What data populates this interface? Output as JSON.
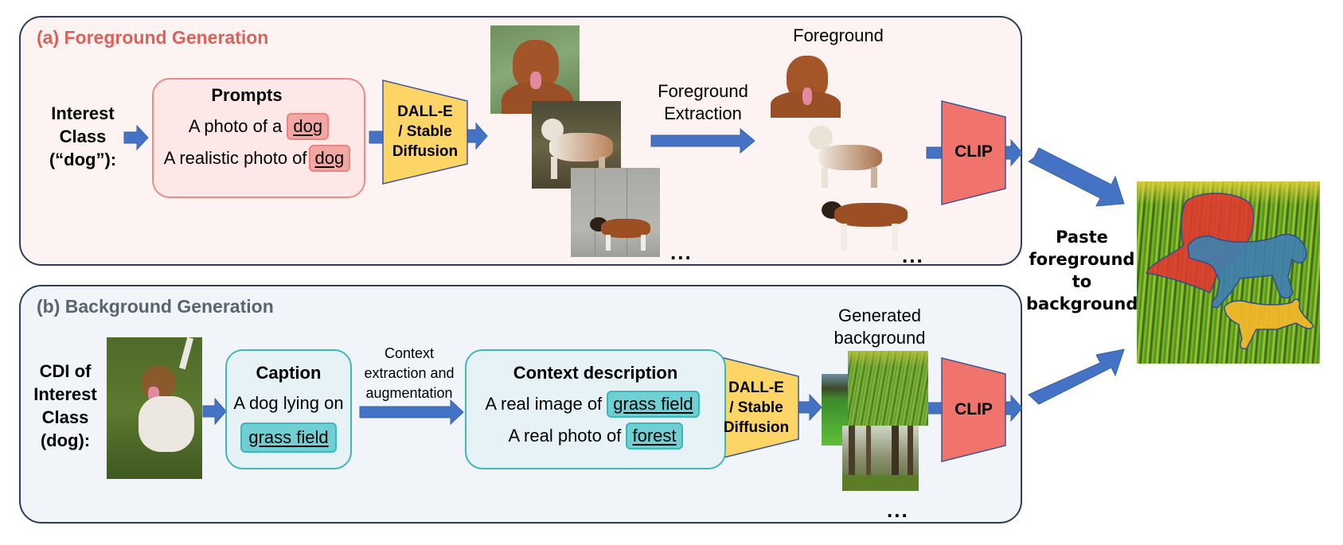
{
  "panel_a": {
    "title": "(a) Foreground Generation",
    "input_label": [
      "Interest",
      "Class",
      "(“dog”):"
    ],
    "prompts": {
      "title": "Prompts",
      "lines": [
        {
          "prefix": "A photo of a",
          "keyword": "dog"
        },
        {
          "prefix": "A realistic photo of",
          "keyword": "dog"
        }
      ]
    },
    "generator": [
      "DALL-E",
      "/ Stable",
      "Diffusion"
    ],
    "generated_images": [
      "golden-retriever-photo",
      "poodle-photo",
      "saint-bernard-photo"
    ],
    "extraction_label": [
      "Foreground",
      "Extraction"
    ],
    "foreground_label": "Foreground",
    "foregrounds": [
      "golden-retriever-cutout",
      "poodle-cutout",
      "saint-bernard-cutout"
    ],
    "ellipsis_images": "...",
    "ellipsis_foregrounds": "...",
    "filter": "CLIP"
  },
  "panel_b": {
    "title": "(b) Background Generation",
    "input_label": [
      "CDI of",
      "Interest",
      "Class",
      "(dog):"
    ],
    "input_image": "jack-russell-on-grass-photo",
    "caption": {
      "title": "Caption",
      "text": "A dog lying on",
      "keyword": "grass field"
    },
    "transform_label": [
      "Context",
      "extraction and",
      "augmentation"
    ],
    "context": {
      "title": "Context description",
      "lines": [
        {
          "prefix": "A real image of",
          "keyword": "grass field"
        },
        {
          "prefix": "A real photo of",
          "keyword": "forest"
        }
      ]
    },
    "generator": [
      "DALL-E",
      "/ Stable",
      "Diffusion"
    ],
    "generated_label": [
      "Generated",
      "background"
    ],
    "backgrounds": [
      "meadow-photo",
      "grass-closeup-photo",
      "forest-photo"
    ],
    "ellipsis": "...",
    "filter": "CLIP"
  },
  "merge": {
    "label": [
      "Paste",
      "foreground",
      "to",
      "background"
    ],
    "result_image": "composite-dogs-on-grass",
    "mask_colors": {
      "dog1": "#e0392f",
      "dog2": "#3f7fae",
      "dog3": "#f0b62a"
    }
  },
  "colors": {
    "arrow": "#4472c4",
    "generator_fill": "#fdd566",
    "clip_fill": "#f0746b",
    "panel_border": "#2c3e5c"
  }
}
